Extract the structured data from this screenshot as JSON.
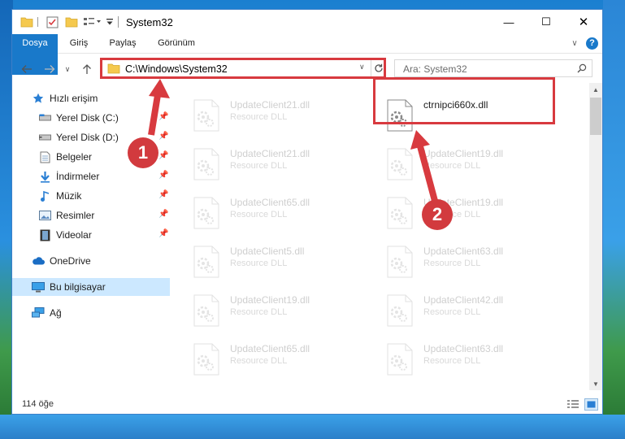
{
  "window": {
    "title": "System32",
    "controls": {
      "minimize": "—",
      "maximize": "☐",
      "close": "✕"
    }
  },
  "ribbon": {
    "tabs": [
      "Dosya",
      "Giriş",
      "Paylaş",
      "Görünüm"
    ],
    "help": "?"
  },
  "nav": {
    "address": "C:\\Windows\\System32",
    "search_placeholder": "Ara: System32"
  },
  "sidebar": {
    "items": [
      {
        "label": "Hızlı erişim",
        "icon": "star-icon"
      },
      {
        "label": "Yerel Disk (C:)",
        "icon": "drive-icon",
        "pinned": true
      },
      {
        "label": "Yerel Disk (D:)",
        "icon": "drive-icon",
        "pinned": true
      },
      {
        "label": "Belgeler",
        "icon": "documents-icon",
        "pinned": true
      },
      {
        "label": "İndirmeler",
        "icon": "download-icon",
        "pinned": true
      },
      {
        "label": "Müzik",
        "icon": "music-icon",
        "pinned": true
      },
      {
        "label": "Resimler",
        "icon": "pictures-icon",
        "pinned": true
      },
      {
        "label": "Videolar",
        "icon": "videos-icon",
        "pinned": true
      },
      {
        "label": "OneDrive",
        "icon": "cloud-icon"
      },
      {
        "label": "Bu bilgisayar",
        "icon": "computer-icon",
        "selected": true
      },
      {
        "label": "Ağ",
        "icon": "network-icon"
      }
    ]
  },
  "files": {
    "left": [
      {
        "name": "UpdateClient21.dll",
        "type": "Resource DLL"
      },
      {
        "name": "UpdateClient21.dll",
        "type": "Resource DLL"
      },
      {
        "name": "UpdateClient65.dll",
        "type": "Resource DLL"
      },
      {
        "name": "UpdateClient5.dll",
        "type": "Resource DLL"
      },
      {
        "name": "UpdateClient19.dll",
        "type": "Resource DLL"
      },
      {
        "name": "UpdateClient65.dll",
        "type": "Resource DLL"
      }
    ],
    "right": [
      {
        "name": "ctrnipci660x.dll",
        "type": ""
      },
      {
        "name": "UpdateClient19.dll",
        "type": "Resource DLL"
      },
      {
        "name": "UpdateClient19.dll",
        "type": "Resource DLL"
      },
      {
        "name": "UpdateClient63.dll",
        "type": "Resource DLL"
      },
      {
        "name": "UpdateClient42.dll",
        "type": "Resource DLL"
      },
      {
        "name": "UpdateClient63.dll",
        "type": "Resource DLL"
      }
    ]
  },
  "status": {
    "count": "114 öğe"
  },
  "annotations": {
    "step1": "1",
    "step2": "2",
    "color": "#d83a3f"
  }
}
